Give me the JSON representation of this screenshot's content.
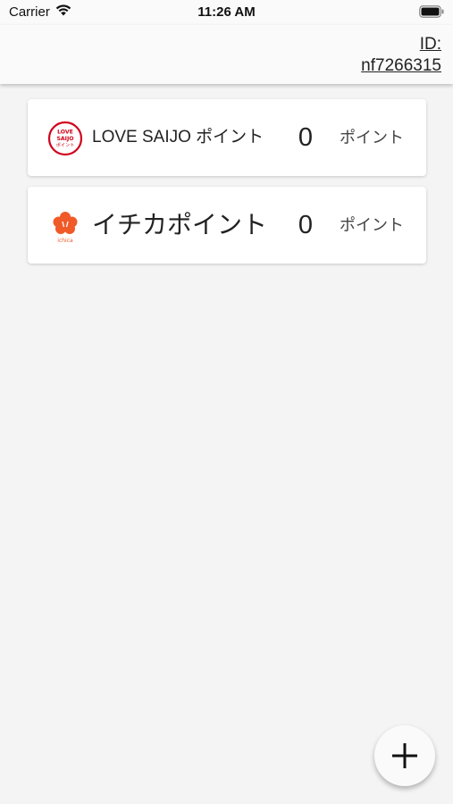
{
  "status_bar": {
    "carrier": "Carrier",
    "time": "11:26 AM"
  },
  "header": {
    "user_id_label": "ID:",
    "user_id_value": "nf7266315"
  },
  "cards": [
    {
      "name": "LOVE SAIJO ポイント",
      "points": "0",
      "unit": "ポイント",
      "icon": "love-saijo-logo",
      "logo_text": [
        "LOVE",
        "SAIJO",
        "ポイント"
      ],
      "accent_color": "#d0021b"
    },
    {
      "name": "イチカポイント",
      "points": "0",
      "unit": "ポイント",
      "icon": "ichica-logo",
      "logo_text": "ichica",
      "accent_color": "#f05a28"
    }
  ],
  "fab": {
    "icon": "plus-icon"
  }
}
